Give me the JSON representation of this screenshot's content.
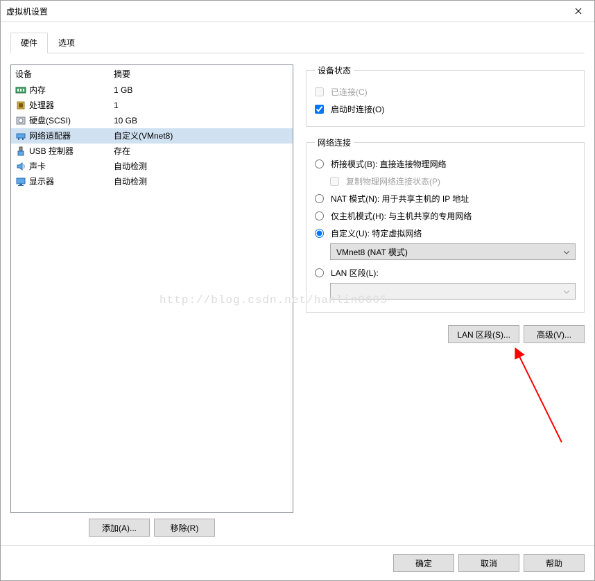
{
  "window": {
    "title": "虚拟机设置"
  },
  "tabs": {
    "hardware": "硬件",
    "options": "选项"
  },
  "device_table": {
    "headers": {
      "device": "设备",
      "summary": "摘要"
    },
    "rows": [
      {
        "name": "内存",
        "summary": "1 GB",
        "icon": "memory-icon",
        "selected": false
      },
      {
        "name": "处理器",
        "summary": "1",
        "icon": "cpu-icon",
        "selected": false
      },
      {
        "name": "硬盘(SCSI)",
        "summary": "10 GB",
        "icon": "disk-icon",
        "selected": false
      },
      {
        "name": "网络适配器",
        "summary": "自定义(VMnet8)",
        "icon": "network-icon",
        "selected": true
      },
      {
        "name": "USB 控制器",
        "summary": "存在",
        "icon": "usb-icon",
        "selected": false
      },
      {
        "name": "声卡",
        "summary": "自动检测",
        "icon": "sound-icon",
        "selected": false
      },
      {
        "name": "显示器",
        "summary": "自动检测",
        "icon": "display-icon",
        "selected": false
      }
    ]
  },
  "left_buttons": {
    "add": "添加(A)...",
    "remove": "移除(R)"
  },
  "device_status": {
    "legend": "设备状态",
    "connected": "已连接(C)",
    "connect_at_power_on": "启动时连接(O)"
  },
  "network_connection": {
    "legend": "网络连接",
    "bridged": "桥接模式(B): 直接连接物理网络",
    "replicate": "复制物理网络连接状态(P)",
    "nat": "NAT 模式(N): 用于共享主机的 IP 地址",
    "hostonly": "仅主机模式(H): 与主机共享的专用网络",
    "custom": "自定义(U): 特定虚拟网络",
    "custom_selected": "VMnet8 (NAT 模式)",
    "lan_segment": "LAN 区段(L):",
    "lan_segment_selected": ""
  },
  "right_buttons": {
    "lan_segments": "LAN 区段(S)...",
    "advanced": "高级(V)..."
  },
  "footer": {
    "ok": "确定",
    "cancel": "取消",
    "help": "帮助"
  },
  "watermark": "http://blog.csdn.net/hanlin0605"
}
